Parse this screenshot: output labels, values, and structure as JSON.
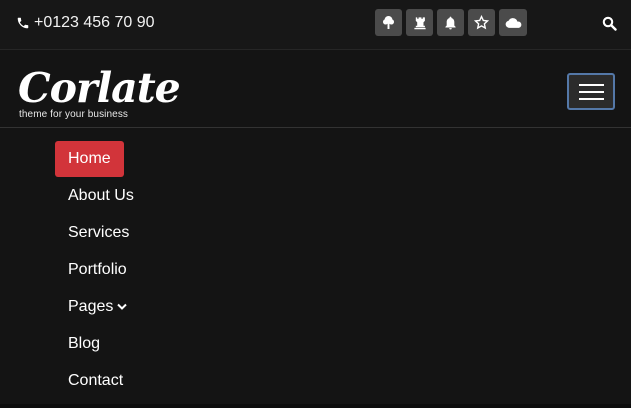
{
  "topbar": {
    "phone": "+0123 456 70 90",
    "social_icons": [
      "tree-icon",
      "chess-rook-icon",
      "bell-icon",
      "star-icon",
      "cloud-icon"
    ],
    "search_icon": "search-icon"
  },
  "logo": {
    "wordmark": "Corlate",
    "tagline": "theme for your business"
  },
  "nav": {
    "items": [
      {
        "label": "Home",
        "active": true
      },
      {
        "label": "About Us"
      },
      {
        "label": "Services"
      },
      {
        "label": "Portfolio"
      },
      {
        "label": "Pages",
        "has_dropdown": true
      },
      {
        "label": "Blog"
      },
      {
        "label": "Contact"
      }
    ]
  },
  "colors": {
    "background": "#141414",
    "active": "#d2343a",
    "social_bg": "#4b4b4b",
    "toggler_border": "#5478a8"
  }
}
